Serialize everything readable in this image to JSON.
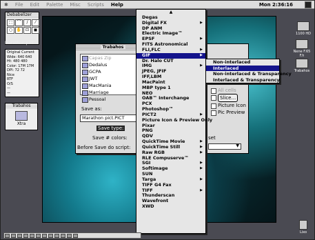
{
  "menubar": {
    "apple": "✱",
    "items": [
      "File",
      "Edit",
      "Palette",
      "Misc",
      "Scripts"
    ],
    "help": "Help",
    "clock": "Mon 2:36:16"
  },
  "toolbox": {
    "title": "Debabelizer"
  },
  "file_label": "Marathon pict",
  "info_panel": {
    "lines": [
      "Original Current",
      "Wide: 640  640",
      "Ht:   480  480",
      "Color: 17M  17M",
      "DPI:   72   72",
      "Nice",
      "RTF",
      "O/S",
      "—",
      "—"
    ]
  },
  "trabahos_window": {
    "title": "Trabahos",
    "folder_label": "Xtra"
  },
  "dialog": {
    "title": "Trabahos",
    "files": [
      {
        "name": "Capas Zip",
        "dim": true
      },
      {
        "name": "Dedalus",
        "dim": false
      },
      {
        "name": "GCPA",
        "dim": false
      },
      {
        "name": "JWT",
        "dim": false
      },
      {
        "name": "MacMania",
        "dim": false
      },
      {
        "name": "Marriage",
        "dim": false
      },
      {
        "name": "Pessoal",
        "dim": false
      }
    ],
    "save_as_label": "Save as:",
    "filename": "Marathon pict.PICT",
    "save_type_label": "Save type:",
    "save_colors_label": "Save # colors:",
    "before_save_label": "Before Save do script:"
  },
  "right_panel": {
    "options": [
      {
        "label": "All cells",
        "dim": true
      },
      {
        "label": "Slice...",
        "dim": false,
        "button": true
      },
      {
        "label": "Picture Icon",
        "dim": false
      },
      {
        "label": "Pic Preview",
        "dim": false
      }
    ],
    "set_label": "set"
  },
  "popup_menu": {
    "top_arrow": "▲",
    "items": [
      {
        "label": "Degas",
        "sub": false
      },
      {
        "label": "Digital FX",
        "sub": true
      },
      {
        "label": "DP ANM",
        "sub": false
      },
      {
        "label": "Electric Image™",
        "sub": false
      },
      {
        "label": "EPSF",
        "sub": true
      },
      {
        "label": "FITS Astronomical",
        "sub": false
      },
      {
        "label": "FLI,FLC",
        "sub": true
      },
      {
        "label": "GIF",
        "sub": true,
        "highlight": true
      },
      {
        "label": "Dr. Halo CUT",
        "sub": false
      },
      {
        "label": "IMG",
        "sub": true
      },
      {
        "label": "JPEG, JFIF",
        "sub": false
      },
      {
        "label": "IFF,LBM",
        "sub": false
      },
      {
        "label": "MacPaint",
        "sub": false
      },
      {
        "label": "MBP type 1",
        "sub": false
      },
      {
        "label": "NEO",
        "sub": false
      },
      {
        "label": "OAB™ Interchange",
        "sub": false
      },
      {
        "label": "PCX",
        "sub": false
      },
      {
        "label": "Photoshop™",
        "sub": false
      },
      {
        "label": "PICT2",
        "sub": true
      },
      {
        "label": "Picture Icon & Preview Only",
        "sub": false
      },
      {
        "label": "Pixar",
        "sub": false
      },
      {
        "label": "PNG",
        "sub": false
      },
      {
        "label": "QDV",
        "sub": false
      },
      {
        "label": "QuickTime Movie",
        "sub": true
      },
      {
        "label": "QuickTime Still",
        "sub": true
      },
      {
        "label": "Raw RGB",
        "sub": true
      },
      {
        "label": "RLE Compuserve™",
        "sub": false
      },
      {
        "label": "SGI",
        "sub": true
      },
      {
        "label": "Softimage",
        "sub": true
      },
      {
        "label": "SUN",
        "sub": false
      },
      {
        "label": "Targa",
        "sub": true
      },
      {
        "label": "TIFF G4 Fax",
        "sub": false
      },
      {
        "label": "TIFF",
        "sub": true
      },
      {
        "label": "Thunderscan",
        "sub": false
      },
      {
        "label": "Wavefront",
        "sub": false
      },
      {
        "label": "XWD",
        "sub": false
      }
    ]
  },
  "gif_submenu": {
    "items": [
      {
        "label": "Non-interlaced",
        "highlight": false
      },
      {
        "label": "Interlaced",
        "highlight": true
      },
      {
        "label": "Non-interlaced & Transparency",
        "highlight": false
      },
      {
        "label": "Interlaced & Transparency",
        "highlight": false
      }
    ]
  },
  "desktop_icons": [
    "1100 HD",
    "Nene F.65 F.h",
    "Trabahos",
    "Lixo"
  ],
  "colors": {
    "highlight": "#14148c",
    "menu_bg": "#e6e6e6"
  }
}
